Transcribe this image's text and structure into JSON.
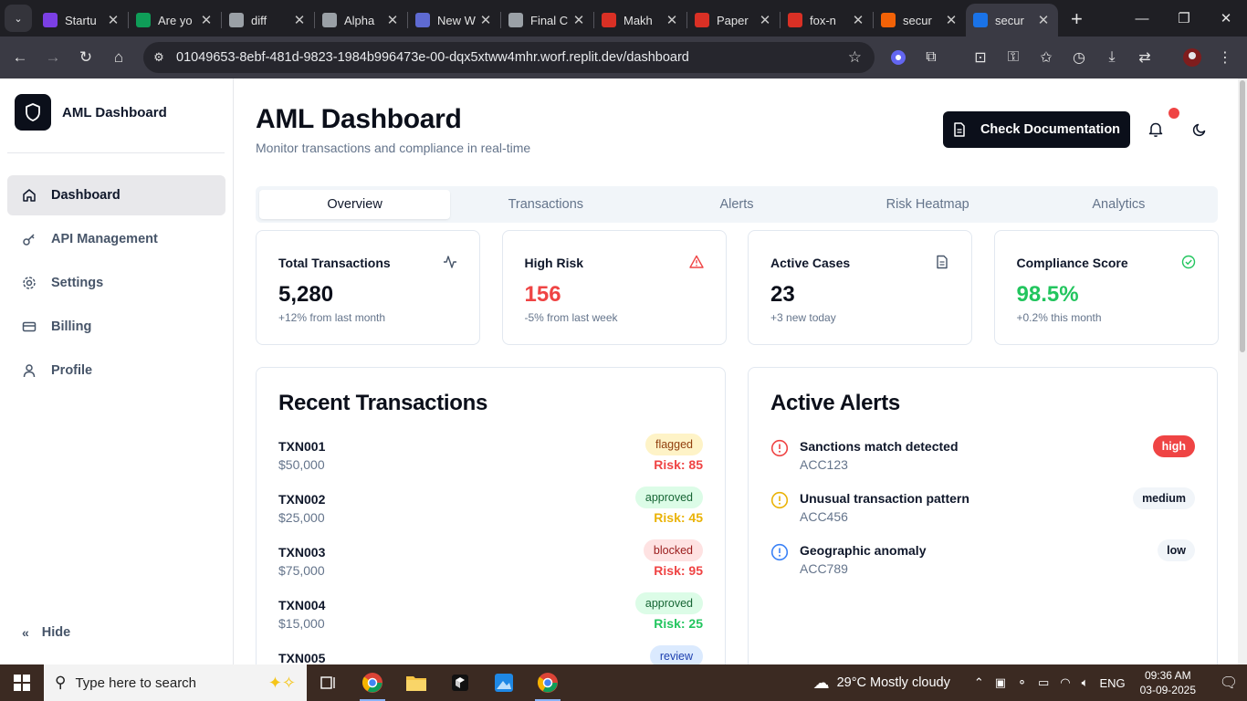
{
  "browser": {
    "tabs": [
      {
        "title": "Startu",
        "icon": "form-icon",
        "color": "#7b3fe4"
      },
      {
        "title": "Are yo",
        "icon": "sheets-icon",
        "color": "#0f9d58"
      },
      {
        "title": "diff",
        "icon": "globe-icon",
        "color": "#9aa0a6"
      },
      {
        "title": "Alpha",
        "icon": "globe-icon",
        "color": "#9aa0a6"
      },
      {
        "title": "New W",
        "icon": "linear-icon",
        "color": "#5e6ad2"
      },
      {
        "title": "Final C",
        "icon": "globe-icon",
        "color": "#9aa0a6"
      },
      {
        "title": "Makh",
        "icon": "gmail-icon",
        "color": "#d93025"
      },
      {
        "title": "Paper",
        "icon": "gmail-icon",
        "color": "#d93025"
      },
      {
        "title": "fox-n",
        "icon": "gmail-icon",
        "color": "#d93025"
      },
      {
        "title": "secur",
        "icon": "replit-icon",
        "color": "#f26207"
      },
      {
        "title": "secur",
        "icon": "replit-icon",
        "color": "#1a73e8",
        "active": true
      }
    ],
    "url": "01049653-8ebf-481d-9823-1984b996473e-00-dqx5xtww4mhr.worf.replit.dev/dashboard"
  },
  "sidebar": {
    "brand": "AML Dashboard",
    "items": [
      {
        "label": "Dashboard",
        "icon": "home-icon",
        "active": true
      },
      {
        "label": "API Management",
        "icon": "key-icon"
      },
      {
        "label": "Settings",
        "icon": "gear-icon"
      },
      {
        "label": "Billing",
        "icon": "credit-card-icon"
      },
      {
        "label": "Profile",
        "icon": "user-icon"
      }
    ],
    "hide_label": "Hide"
  },
  "header": {
    "title": "AML Dashboard",
    "subtitle": "Monitor transactions and compliance in real-time",
    "doc_button": "Check Documentation"
  },
  "tabs": [
    "Overview",
    "Transactions",
    "Alerts",
    "Risk Heatmap",
    "Analytics"
  ],
  "stats": [
    {
      "label": "Total Transactions",
      "value": "5,280",
      "delta": "+12% from last month",
      "icon": "activity-icon",
      "color": "#0b0f1a"
    },
    {
      "label": "High Risk",
      "value": "156",
      "delta": "-5% from last week",
      "icon": "warning-icon",
      "color": "#ef4444"
    },
    {
      "label": "Active Cases",
      "value": "23",
      "delta": "+3 new today",
      "icon": "file-icon",
      "color": "#0b0f1a"
    },
    {
      "label": "Compliance Score",
      "value": "98.5%",
      "delta": "+0.2% this month",
      "icon": "check-circle-icon",
      "color": "#22c55e"
    }
  ],
  "recent_transactions": {
    "title": "Recent Transactions",
    "rows": [
      {
        "id": "TXN001",
        "amount": "$50,000",
        "status": "flagged",
        "risk": "Risk: 85"
      },
      {
        "id": "TXN002",
        "amount": "$25,000",
        "status": "approved",
        "risk": "Risk: 45"
      },
      {
        "id": "TXN003",
        "amount": "$75,000",
        "status": "blocked",
        "risk": "Risk: 95"
      },
      {
        "id": "TXN004",
        "amount": "$15,000",
        "status": "approved",
        "risk": "Risk: 25"
      },
      {
        "id": "TXN005",
        "amount": "",
        "status": "review",
        "risk": ""
      }
    ]
  },
  "active_alerts": {
    "title": "Active Alerts",
    "items": [
      {
        "message": "Sanctions match detected",
        "account": "ACC123",
        "severity": "high"
      },
      {
        "message": "Unusual transaction pattern",
        "account": "ACC456",
        "severity": "medium"
      },
      {
        "message": "Geographic anomaly",
        "account": "ACC789",
        "severity": "low"
      }
    ]
  },
  "colors": {
    "status_flagged_bg": "#fef3c7",
    "status_flagged_fg": "#92400e",
    "status_approved_bg": "#dcfce7",
    "status_approved_fg": "#166534",
    "status_blocked_bg": "#fee2e2",
    "status_blocked_fg": "#991b1b",
    "status_review_bg": "#dbeafe",
    "status_review_fg": "#1e40af",
    "risk_high": "#ef4444",
    "risk_medium": "#eab308",
    "risk_low": "#22c55e",
    "sev_high_bg": "#ef4444",
    "sev_other_bg": "#f1f5f9"
  },
  "taskbar": {
    "search_placeholder": "Type here to search",
    "weather": "29°C  Mostly cloudy",
    "lang": "ENG",
    "time": "09:36 AM",
    "date": "03-09-2025"
  }
}
